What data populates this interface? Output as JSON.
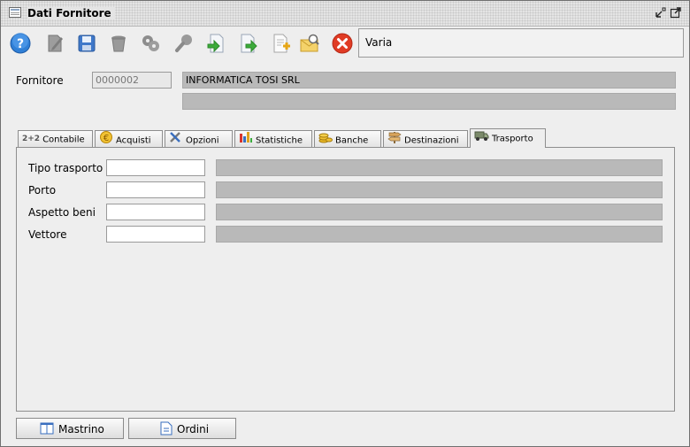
{
  "window": {
    "title": "Dati Fornitore",
    "minimize_icon": "minimize-arrow-icon",
    "maximize_icon": "maximize-arrow-icon"
  },
  "toolbar": {
    "buttons": [
      {
        "name": "help",
        "icon": "help-icon"
      },
      {
        "name": "edit",
        "icon": "edit-icon"
      },
      {
        "name": "save",
        "icon": "save-icon"
      },
      {
        "name": "delete",
        "icon": "trash-icon"
      },
      {
        "name": "cancel-edit",
        "icon": "gears-icon"
      },
      {
        "name": "search",
        "icon": "search-icon"
      },
      {
        "name": "import",
        "icon": "import-icon"
      },
      {
        "name": "export",
        "icon": "export-icon"
      },
      {
        "name": "new-document",
        "icon": "new-document-icon"
      },
      {
        "name": "mail",
        "icon": "mail-icon"
      },
      {
        "name": "close",
        "icon": "close-icon"
      }
    ],
    "info_text": "Varia"
  },
  "fornitore": {
    "label": "Fornitore",
    "code": "0000002",
    "name": "INFORMATICA TOSI SRL",
    "description": ""
  },
  "tabs": [
    {
      "prefix": "2+2",
      "label": "Contabile",
      "icon": "accounting-icon",
      "active": false
    },
    {
      "label": "Acquisti",
      "icon": "euro-icon",
      "active": false
    },
    {
      "label": "Opzioni",
      "icon": "tools-icon",
      "active": false
    },
    {
      "label": "Statistiche",
      "icon": "bar-chart-icon",
      "active": false
    },
    {
      "label": "Banche",
      "icon": "coins-icon",
      "active": false
    },
    {
      "label": "Destinazioni",
      "icon": "signpost-icon",
      "active": false
    },
    {
      "label": "Trasporto",
      "icon": "truck-icon",
      "active": true
    }
  ],
  "trasporto": {
    "fields": [
      {
        "label": "Tipo trasporto",
        "code": "",
        "description": ""
      },
      {
        "label": "Porto",
        "code": "",
        "description": ""
      },
      {
        "label": "Aspetto beni",
        "code": "",
        "description": ""
      },
      {
        "label": "Vettore",
        "code": "",
        "description": ""
      }
    ]
  },
  "bottom_buttons": [
    {
      "label": "Mastrino",
      "icon": "ledger-icon"
    },
    {
      "label": "Ordini",
      "icon": "document-icon"
    }
  ],
  "colors": {
    "close_red": "#e03b24",
    "help_blue": "#2f7fd6",
    "readonly_gray": "#b9b9b9"
  }
}
